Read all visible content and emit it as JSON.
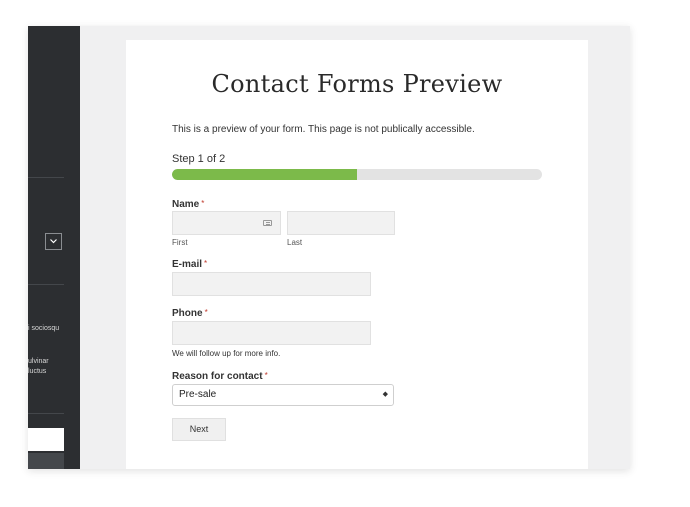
{
  "sidebar": {
    "text_1": "i sociosqu",
    "text_2": "ulvinar",
    "text_3": "luctus",
    "dropdown_icon": "chevron-down-icon"
  },
  "page": {
    "title": "Contact Forms Preview",
    "intro": "This is a preview of your form. This page is not publically accessible.",
    "step": "Step 1 of 2",
    "progress": 0.5,
    "progress_color": "#7cba4a"
  },
  "form": {
    "name": {
      "label": "Name",
      "required": "*",
      "first_label": "First",
      "last_label": "Last",
      "first_value": "",
      "last_value": ""
    },
    "email": {
      "label": "E-mail",
      "required": "*",
      "value": ""
    },
    "phone": {
      "label": "Phone",
      "required": "*",
      "value": "",
      "help": "We will follow up for more info."
    },
    "reason": {
      "label": "Reason for contact",
      "required": "*",
      "selected": "Pre-sale",
      "arrows": "◆"
    },
    "next_label": "Next"
  }
}
